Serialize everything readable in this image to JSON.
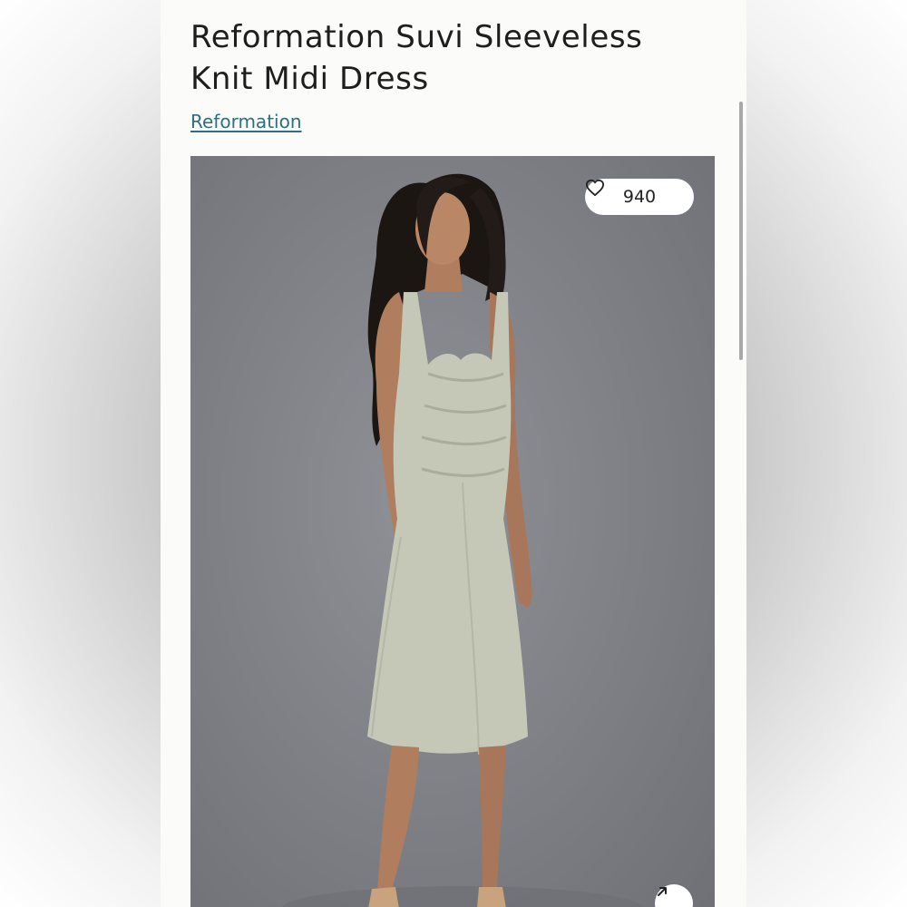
{
  "product": {
    "title": "Reformation Suvi Sleeveless Knit Midi Dress",
    "brand": "Reformation"
  },
  "image": {
    "likes": "940",
    "like_icon": "heart-outline-icon",
    "expand_icon": "arrow-up-right-icon"
  },
  "colors": {
    "brand_link": "#2f6e80",
    "page_background": "#fbfbf9",
    "photo_backdrop": "#84868b",
    "dress": "#c5c8b6"
  }
}
